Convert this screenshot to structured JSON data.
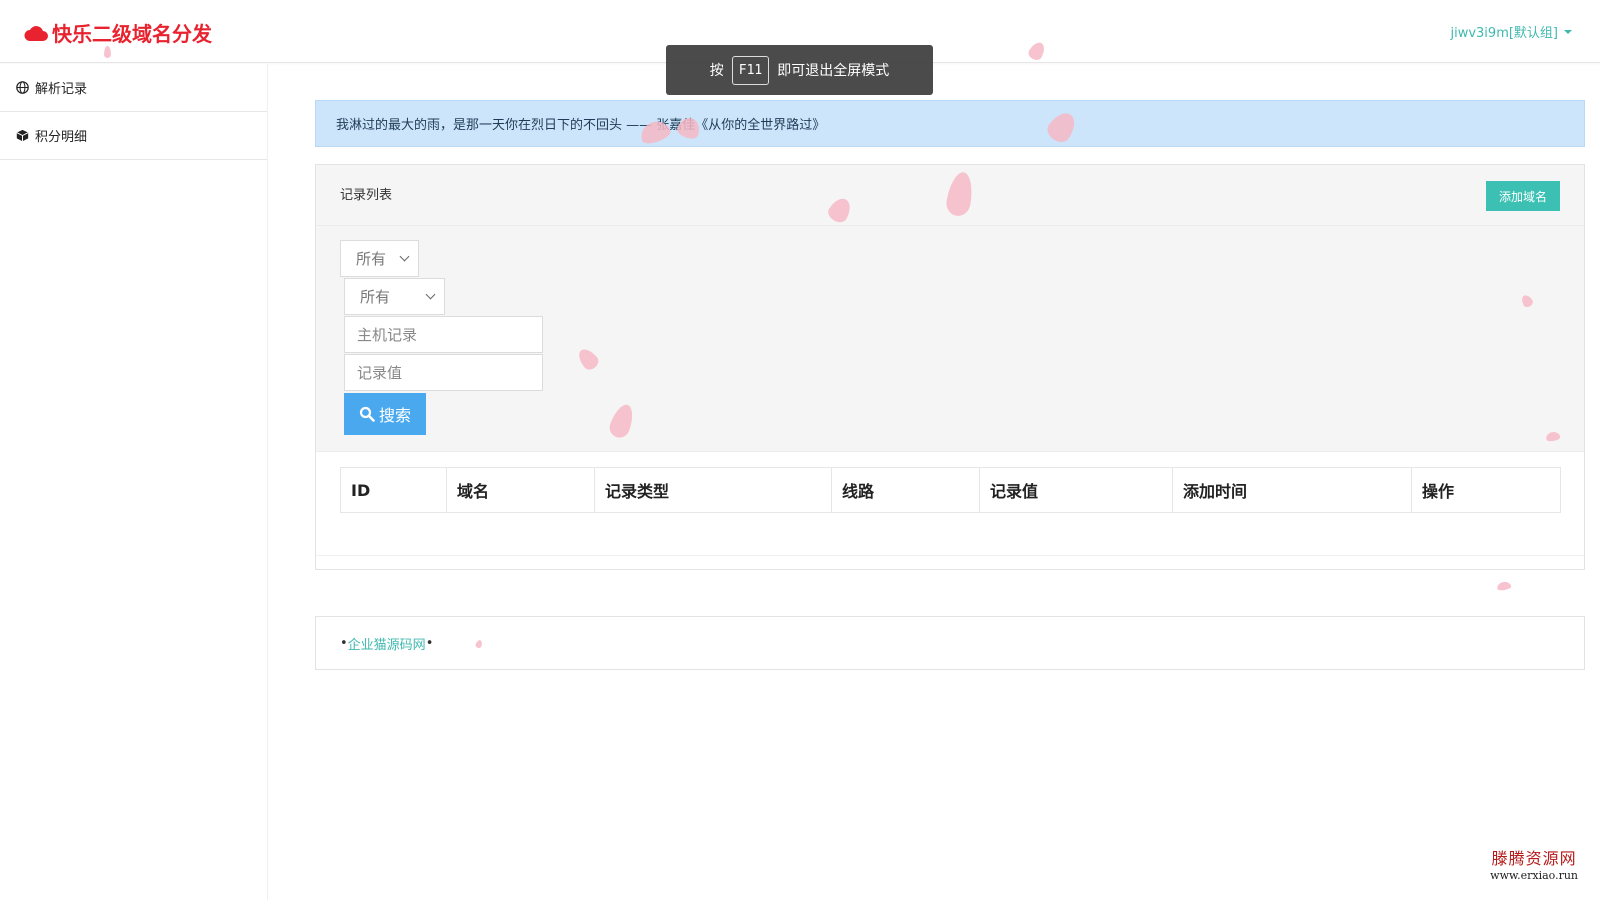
{
  "brand": {
    "title": "快乐二级域名分发"
  },
  "user": {
    "label": "jiwv3i9m[默认组]"
  },
  "toast": {
    "prefix": "按",
    "key": "F11",
    "suffix": "即可退出全屏模式"
  },
  "sidebar": {
    "items": [
      {
        "label": "解析记录",
        "icon": "globe-icon"
      },
      {
        "label": "积分明细",
        "icon": "cube-icon"
      }
    ]
  },
  "notice": {
    "text": "我淋过的最大的雨，是那一天你在烈日下的不回头  —— 张嘉佳《从你的全世界路过》"
  },
  "panel": {
    "title": "记录列表",
    "add_label": "添加域名",
    "filters": {
      "select1_value": "所有",
      "select2_value": "所有",
      "host_placeholder": "主机记录",
      "value_placeholder": "记录值",
      "search_label": "搜索"
    },
    "table": {
      "headers": [
        "ID",
        "域名",
        "记录类型",
        "线路",
        "记录值",
        "添加时间",
        "操作"
      ]
    }
  },
  "footer": {
    "bullet": "•",
    "link": "企业猫源码网"
  },
  "watermark": {
    "title": "滕腾资源网",
    "url": "www.erxiao.run"
  },
  "colors": {
    "brand": "#e8232f",
    "accent": "#3fb8af",
    "primary": "#4aa9ee",
    "notice_bg": "#cce5fb"
  }
}
